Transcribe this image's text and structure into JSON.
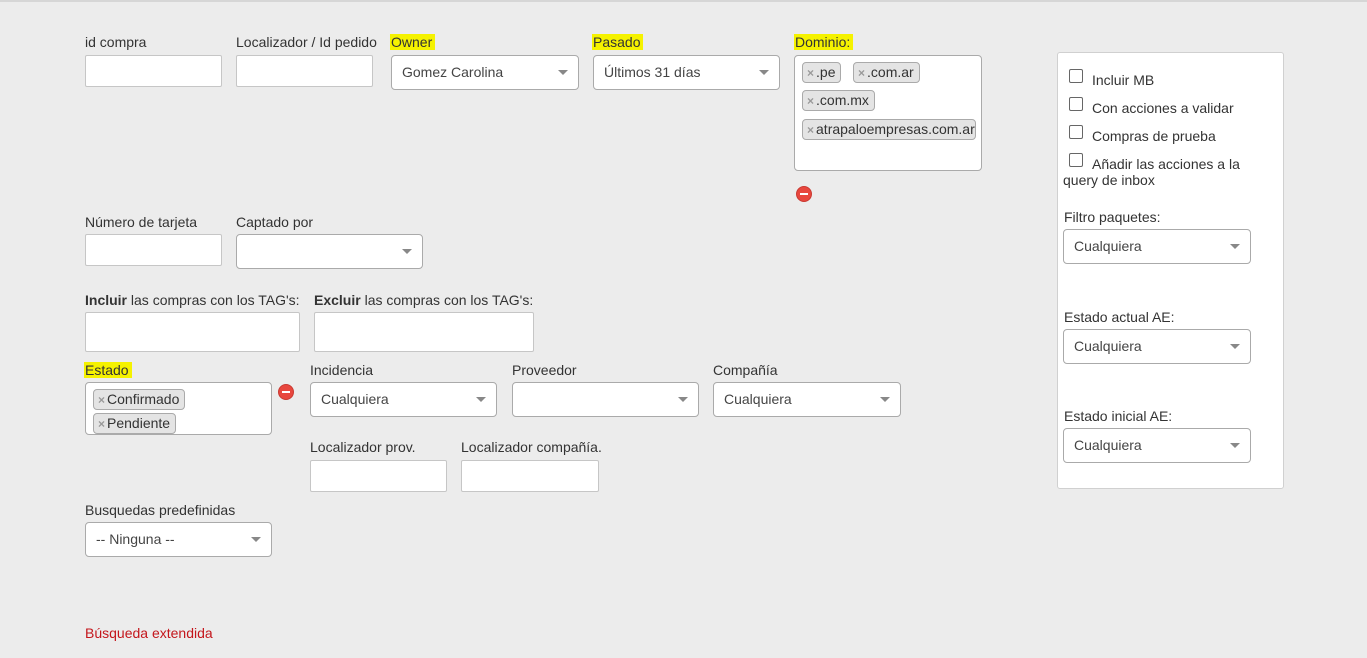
{
  "labels": {
    "id_compra": "id compra",
    "localizador": "Localizador / Id pedido",
    "owner": "Owner",
    "pasado": "Pasado",
    "dominio": "Dominio:",
    "numero_tarjeta": "Número de tarjeta",
    "captado_por": "Captado por",
    "incluir_bold": "Incluir",
    "incluir_rest": " las compras con los TAG's:",
    "excluir_bold": "Excluir",
    "excluir_rest": " las compras con los TAG's:",
    "estado": "Estado",
    "incidencia": "Incidencia",
    "proveedor": "Proveedor",
    "compania": "Compañía",
    "localizador_prov": "Localizador prov.",
    "localizador_compania": "Localizador compañía.",
    "busquedas": "Busquedas predefinidas"
  },
  "fields": {
    "owner_value": "Gomez Carolina",
    "pasado_value": "Últimos 31 días",
    "captado_value": "",
    "incidencia_value": "Cualquiera",
    "proveedor_value": "",
    "compania_value": "Cualquiera",
    "busquedas_value": "-- Ninguna --"
  },
  "dominio_tags": [
    ".pe",
    ".com.ar",
    ".com.mx",
    "atrapaloempresas.com.ar"
  ],
  "estado_tags": [
    "Confirmado",
    "Pendiente"
  ],
  "tag_remove_glyph": "×",
  "panel": {
    "checkboxes": [
      "Incluir MB",
      "Con acciones a validar",
      "Compras de prueba",
      "Añadir las acciones a la"
    ],
    "checkbox_continuation": "query de inbox",
    "filtro_paquetes_label": "Filtro paquetes:",
    "filtro_paquetes_value": "Cualquiera",
    "estado_actual_label": "Estado actual AE:",
    "estado_actual_value": "Cualquiera",
    "estado_inicial_label": "Estado inicial AE:",
    "estado_inicial_value": "Cualquiera"
  },
  "busqueda_extendida": "Búsqueda extendida",
  "colors": {
    "highlight": "#f5f200",
    "link": "#c4161c",
    "remove": "#e8473e",
    "background": "#ececec"
  }
}
